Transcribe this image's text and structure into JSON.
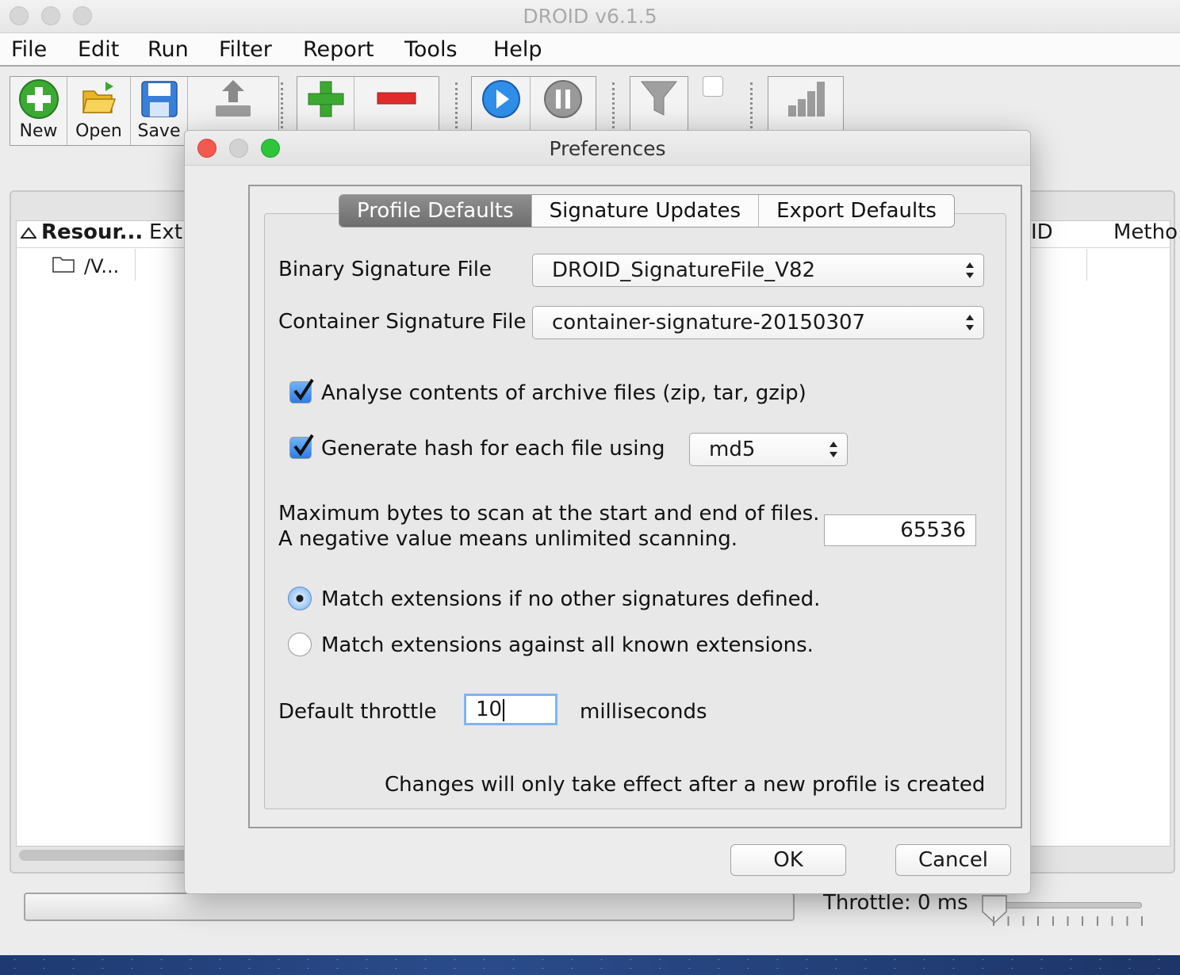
{
  "app": {
    "title": "DROID v6.1.5"
  },
  "menu": [
    "File",
    "Edit",
    "Run",
    "Filter",
    "Report",
    "Tools",
    "Help"
  ],
  "toolbar": {
    "new_label": "New",
    "open_label": "Open",
    "save_label": "Save"
  },
  "table": {
    "columns": {
      "resource": "Resour...",
      "ext": "Ext",
      "id": "ID",
      "method": "Metho"
    },
    "rows": [
      {
        "resource": "/V..."
      }
    ]
  },
  "status": {
    "throttle": "Throttle: 0 ms",
    "throttle_value": 0
  },
  "dialog": {
    "title": "Preferences",
    "tabs": [
      "Profile Defaults",
      "Signature Updates",
      "Export Defaults"
    ],
    "active_tab": "Profile Defaults",
    "binary_sig_label": "Binary Signature File",
    "binary_sig_value": "DROID_SignatureFile_V82",
    "container_sig_label": "Container Signature File",
    "container_sig_value": "container-signature-20150307",
    "analyse_archives_label": "Analyse contents of archive files (zip, tar, gzip)",
    "analyse_archives_checked": true,
    "generate_hash_label": "Generate hash for each file using",
    "generate_hash_checked": true,
    "hash_algorithm": "md5",
    "max_bytes_line1": "Maximum bytes to scan at the start and end of files.",
    "max_bytes_line2": "A negative value means unlimited scanning.",
    "max_bytes_value": "65536",
    "match_ext_option1": "Match extensions if no other signatures defined.",
    "match_ext_option2": "Match extensions against all known extensions.",
    "match_ext_selected": 1,
    "throttle_label": "Default throttle",
    "throttle_value": "10",
    "throttle_unit": "milliseconds",
    "note": "Changes will only take effect after a new profile is created",
    "ok_label": "OK",
    "cancel_label": "Cancel"
  },
  "colors": {
    "accent": "#2d7de6",
    "active_tab": "#7a7a7a",
    "close": "#f25a50",
    "zoom": "#2ec43c"
  }
}
